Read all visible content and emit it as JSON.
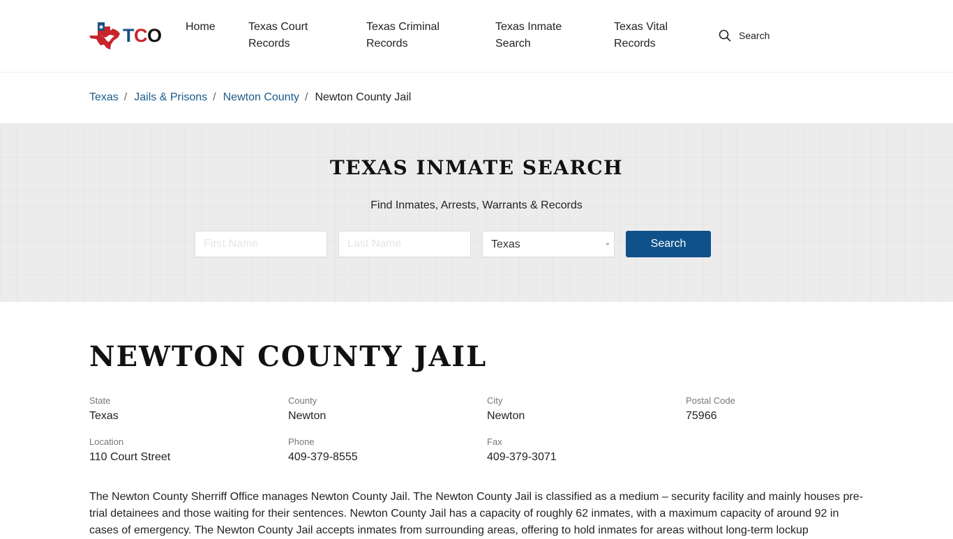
{
  "header": {
    "logo_text": [
      "T",
      "C",
      "O"
    ],
    "nav": [
      {
        "label": "Home"
      },
      {
        "label": "Texas Court Records"
      },
      {
        "label": "Texas Criminal Records"
      },
      {
        "label": "Texas Inmate Search"
      },
      {
        "label": "Texas Vital Records"
      }
    ],
    "search_label": "Search",
    "search_icon": "magnifier"
  },
  "breadcrumb": {
    "items": [
      {
        "label": "Texas"
      },
      {
        "label": "Jails & Prisons"
      },
      {
        "label": "Newton County"
      }
    ],
    "current": "Newton County Jail",
    "separator": "/"
  },
  "hero": {
    "title": "TEXAS INMATE SEARCH",
    "subtitle": "Find Inmates, Arrests, Warrants & Records",
    "first_name_placeholder": "First Name",
    "last_name_placeholder": "Last Name",
    "state_selected": "Texas",
    "search_button": "Search"
  },
  "colors": {
    "brand_blue": "#0f518a",
    "link_blue": "#1a5a8a",
    "logo_red": "#c8242b"
  },
  "main": {
    "title": "NEWTON COUNTY JAIL",
    "info": [
      {
        "label": "State",
        "value": "Texas"
      },
      {
        "label": "County",
        "value": "Newton"
      },
      {
        "label": "City",
        "value": "Newton"
      },
      {
        "label": "Postal Code",
        "value": "75966"
      },
      {
        "label": "Location",
        "value": "110 Court Street"
      },
      {
        "label": "Phone",
        "value": "409-379-8555"
      },
      {
        "label": "Fax",
        "value": "409-379-3071"
      }
    ],
    "description": "The Newton County Sherriff Office manages Newton County Jail. The Newton County Jail is classified as a medium – security facility and mainly houses pre-trial detainees and those waiting for their sentences. Newton County Jail has a capacity of roughly 62 inmates, with a maximum capacity of around 92 in cases of emergency. The Newton County Jail accepts inmates from surrounding areas, offering to hold inmates for areas without long-term lockup"
  }
}
